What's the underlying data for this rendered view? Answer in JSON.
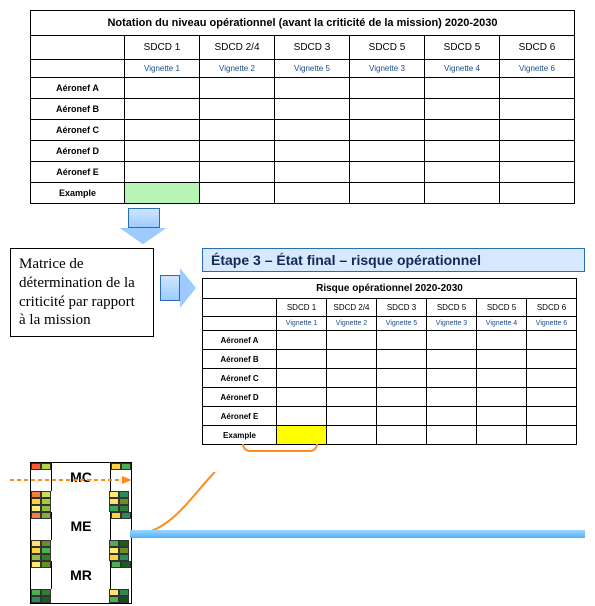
{
  "table1": {
    "title": "Notation du niveau opérationnel (avant la criticité de la mission) 2020-2030",
    "cols": [
      "SDCD 1",
      "SDCD 2/4",
      "SDCD 3",
      "SDCD 5",
      "SDCD 5",
      "SDCD 6"
    ],
    "vignettes": [
      "Vignette 1",
      "Vignette 2",
      "Vignette 5",
      "Vignette 3",
      "Vignette 4",
      "Vignette 6"
    ],
    "rows": [
      "Aéronef A",
      "Aéronef B",
      "Aéronef C",
      "Aéronef D",
      "Aéronef E",
      "Example"
    ],
    "highlight": {
      "row": 5,
      "col": 0,
      "class": "green-cell"
    }
  },
  "matrix_label": "Matrice de détermination de la criticité par rapport à la mission",
  "step3_title": "Étape 3 – État final – risque opérationnel",
  "table2": {
    "title": "Risque opérationnel 2020-2030",
    "cols": [
      "SDCD 1",
      "SDCD 2/4",
      "SDCD 3",
      "SDCD 5",
      "SDCD 5",
      "SDCD 6"
    ],
    "vignettes": [
      "Vignette 1",
      "Vignette 2",
      "Vignette 5",
      "Vignette 3",
      "Vignette 4",
      "Vignette 6"
    ],
    "rows": [
      "Aéronef A",
      "Aéronef B",
      "Aéronef C",
      "Aéronef D",
      "Aéronef E",
      "Example"
    ],
    "highlight": {
      "row": 5,
      "col": 0,
      "class": "yellow-cell"
    }
  },
  "color_grid": {
    "labels": [
      "MC",
      "ME",
      "MR"
    ],
    "palette": [
      [
        "#ff5b2e",
        "#b4d24a",
        "#ffd23f",
        "#4caf50"
      ],
      [
        "#f47c3c",
        "#c7dc5a",
        "#ffec6e",
        "#2e8b57"
      ],
      [
        "#ffd23f",
        "#a5c939",
        "#ffe26e",
        "#6b8e23"
      ],
      [
        "#fff07a",
        "#8fbf3f",
        "#3aa655",
        "#2e7d32"
      ],
      [
        "#f47c3c",
        "#7fae3a",
        "#ffd23f",
        "#2e8b57"
      ],
      [
        "#ffe26e",
        "#6b8e23",
        "#4caf50",
        "#1b5e20"
      ],
      [
        "#ffd23f",
        "#4caf50",
        "#ffec6e",
        "#6b8e23"
      ],
      [
        "#8fbf3f",
        "#2e7d32",
        "#ffd23f",
        "#2e8b57"
      ],
      [
        "#ffec6e",
        "#6b8e23",
        "#4caf50",
        "#1b5e20"
      ],
      [
        "#4caf50",
        "#2e7d32",
        "#ffe26e",
        "#2e8b57"
      ],
      [
        "#2e8b57",
        "#1b5e20",
        "#4caf50",
        "#145214"
      ]
    ]
  }
}
